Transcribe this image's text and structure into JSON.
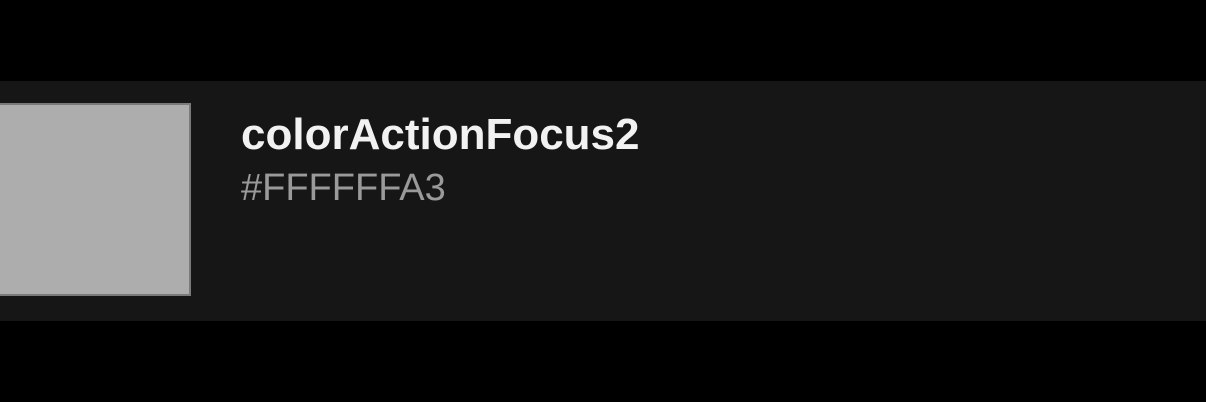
{
  "color_token": {
    "name": "colorActionFocus2",
    "value": "#FFFFFFA3",
    "swatch_color": "#adadad"
  },
  "colors": {
    "page_background": "#000000",
    "row_background": "#161616",
    "name_text": "#f2f2f2",
    "value_text": "#9a9a9a"
  }
}
